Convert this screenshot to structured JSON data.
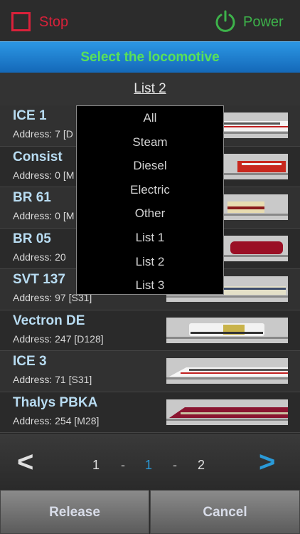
{
  "header": {
    "stop_label": "Stop",
    "power_label": "Power",
    "stop_color": "#d9213a",
    "power_color": "#3db24a"
  },
  "title": "Select the locomotive",
  "list_heading": "List 2",
  "locomotives": [
    {
      "name": "ICE 1",
      "address": "Address: 7 [D",
      "icon": "ice1-train-thumbnail"
    },
    {
      "name": "Consist",
      "address": "Address: 0 [M",
      "icon": "red-locomotive-thumbnail"
    },
    {
      "name": "BR 61",
      "address": "Address: 0 [M",
      "icon": "streamline-locomotive-thumbnail"
    },
    {
      "name": "BR 05",
      "address": "Address: 20",
      "icon": "red-steam-locomotive-thumbnail"
    },
    {
      "name": "SVT 137",
      "address": "Address: 97 [S31]",
      "icon": "railcar-thumbnail"
    },
    {
      "name": "Vectron DE",
      "address": "Address: 247 [D128]",
      "icon": "vectron-locomotive-thumbnail"
    },
    {
      "name": "ICE 3",
      "address": "Address: 71 [S31]",
      "icon": "ice3-train-thumbnail"
    },
    {
      "name": "Thalys PBKA",
      "address": "Address: 254 [M28]",
      "icon": "thalys-train-thumbnail"
    }
  ],
  "dropdown": {
    "options": [
      "All",
      "Steam",
      "Diesel",
      "Electric",
      "Other",
      "List 1",
      "List 2",
      "List 3"
    ]
  },
  "pager": {
    "prev": "<",
    "next": ">",
    "first": "1",
    "sep1": "-",
    "current": "1",
    "sep2": "-",
    "last": "2",
    "accent": "#2a9ad8"
  },
  "footer": {
    "release_label": "Release",
    "cancel_label": "Cancel"
  }
}
